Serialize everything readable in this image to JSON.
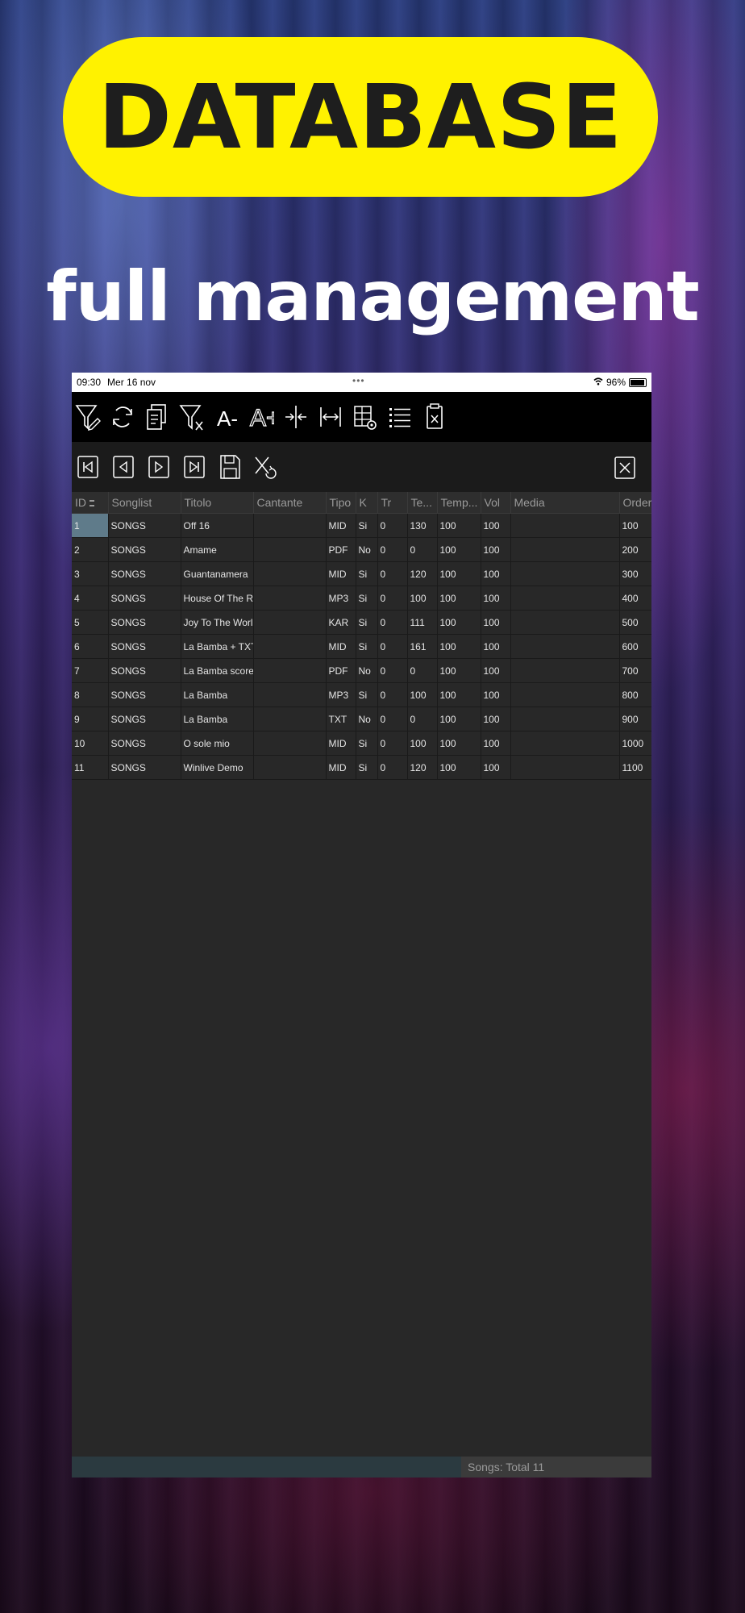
{
  "banner": {
    "title": "DATABASE"
  },
  "subtitle": "full management",
  "statusbar": {
    "time": "09:30",
    "date": "Mer 16 nov",
    "battery": "96%"
  },
  "toolbar": {
    "icons": [
      "filter-edit-icon",
      "refresh-icon",
      "copy-document-icon",
      "filter-clear-icon",
      "font-decrease-icon",
      "font-increase-icon",
      "column-shrink-icon",
      "column-expand-icon",
      "table-settings-icon",
      "list-view-icon",
      "delete-clipboard-icon"
    ],
    "font_decrease": "A-",
    "font_increase": "A+"
  },
  "navbar": {
    "icons": [
      "first-record-icon",
      "previous-record-icon",
      "next-record-icon",
      "last-record-icon",
      "save-icon",
      "undo-cancel-icon",
      "close-icon"
    ]
  },
  "table": {
    "headers": [
      "ID",
      "Songlist",
      "Titolo",
      "Cantante",
      "Tipo",
      "K",
      "Tr",
      "Te...",
      "Temp...",
      "Vol",
      "Media",
      "Order"
    ],
    "rows": [
      [
        "1",
        "SONGS",
        "Off 16",
        "",
        "MID",
        "Si",
        "0",
        "130",
        "100",
        "100",
        "",
        "100"
      ],
      [
        "2",
        "SONGS",
        "Amame",
        "",
        "PDF",
        "No",
        "0",
        "0",
        "100",
        "100",
        "",
        "200"
      ],
      [
        "3",
        "SONGS",
        "Guantanamera",
        "",
        "MID",
        "Si",
        "0",
        "120",
        "100",
        "100",
        "",
        "300"
      ],
      [
        "4",
        "SONGS",
        "House Of The Ris",
        "",
        "MP3",
        "Si",
        "0",
        "100",
        "100",
        "100",
        "",
        "400"
      ],
      [
        "5",
        "SONGS",
        "Joy To The World",
        "",
        "KAR",
        "Si",
        "0",
        "111",
        "100",
        "100",
        "",
        "500"
      ],
      [
        "6",
        "SONGS",
        "La Bamba + TXT",
        "",
        "MID",
        "Si",
        "0",
        "161",
        "100",
        "100",
        "",
        "600"
      ],
      [
        "7",
        "SONGS",
        "La Bamba score",
        "",
        "PDF",
        "No",
        "0",
        "0",
        "100",
        "100",
        "",
        "700"
      ],
      [
        "8",
        "SONGS",
        "La Bamba",
        "",
        "MP3",
        "Si",
        "0",
        "100",
        "100",
        "100",
        "",
        "800"
      ],
      [
        "9",
        "SONGS",
        "La Bamba",
        "",
        "TXT",
        "No",
        "0",
        "0",
        "100",
        "100",
        "",
        "900"
      ],
      [
        "10",
        "SONGS",
        "O sole mio",
        "",
        "MID",
        "Si",
        "0",
        "100",
        "100",
        "100",
        "",
        "1000"
      ],
      [
        "11",
        "SONGS",
        "Winlive Demo",
        "",
        "MID",
        "Si",
        "0",
        "120",
        "100",
        "100",
        "",
        "1100"
      ]
    ]
  },
  "footer": {
    "count": "Songs: Total 11"
  },
  "colors": {
    "banner": "#fff200",
    "app_bg": "#282828",
    "toolbar_bg": "#000000",
    "selected_cell": "#5f7b8a"
  }
}
